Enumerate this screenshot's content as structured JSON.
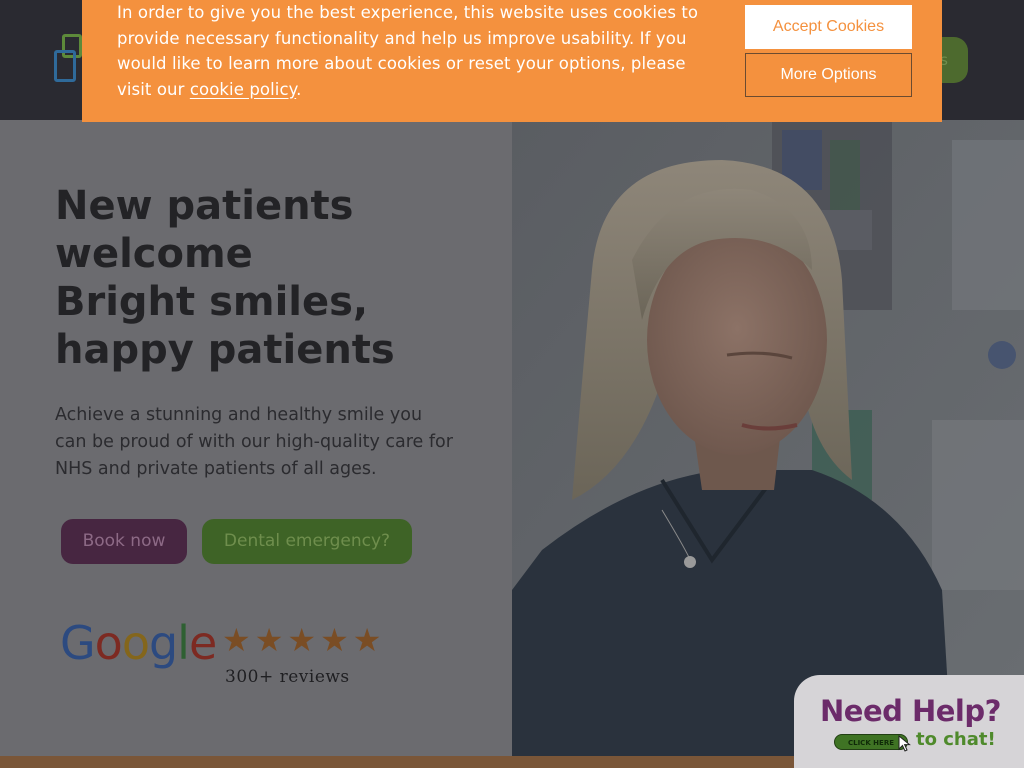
{
  "cookie_banner": {
    "text_before_link": "In order to give you the best experience, this website uses cookies to provide necessary functionality and help us improve usability. If you would like to learn more about cookies or reset your options, please visit our ",
    "link_text": "cookie policy",
    "text_after_link": ".",
    "accept_label": "Accept Cookies",
    "more_label": "More Options"
  },
  "header": {
    "cta_label": "s"
  },
  "hero": {
    "title": "New patients welcome",
    "subtitle": "Bright smiles, happy patients",
    "description": "Achieve a stunning and healthy smile you can be proud of with our high-quality care for NHS and private patients of all ages.",
    "book_label": "Book now",
    "emergency_label": "Dental emergency?"
  },
  "reviews": {
    "google_letters": [
      "G",
      "o",
      "o",
      "g",
      "l",
      "e"
    ],
    "stars": 5,
    "count_text": "300+ reviews"
  },
  "chat": {
    "title": "Need Help?",
    "click_label": "CLICK HERE",
    "subtitle": "to chat!"
  },
  "colors": {
    "cookie_orange": "#f4913e",
    "book_purple": "#472641",
    "emergency_green": "#3e6326",
    "chat_purple": "#6c2b6a",
    "chat_green": "#4f8a2c"
  }
}
